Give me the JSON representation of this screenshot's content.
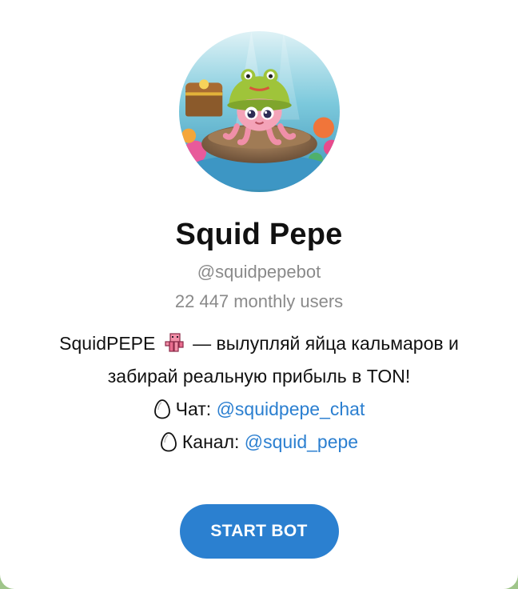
{
  "bot": {
    "name": "Squid Pepe",
    "username": "@squidpepebot",
    "monthly_users": "22 447 monthly users"
  },
  "description": {
    "line1_prefix": "SquidPEPE",
    "line1_suffix": "— вылупляй яйца кальмаров и",
    "line2": "забирай реальную прибыль в TON!",
    "chat_label": "Чат:",
    "chat_link": "@squidpepe_chat",
    "channel_label": "Канал:",
    "channel_link": "@squid_pepe"
  },
  "icons": {
    "squid": "squid-emoji-icon",
    "egg": "egg-icon"
  },
  "actions": {
    "start_label": "START BOT"
  },
  "colors": {
    "link": "#2b7fd0",
    "button": "#2b80d0",
    "muted_text": "#8a8a8a",
    "background_outer": "#9fc58a"
  }
}
